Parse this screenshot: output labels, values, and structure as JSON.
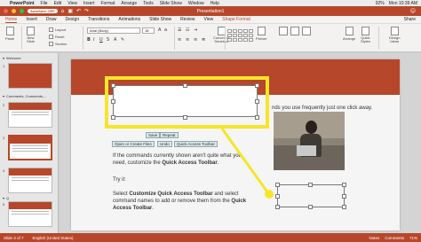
{
  "menubar": {
    "apple_glyph": "",
    "app_name": "PowerPoint",
    "items": [
      "File",
      "Edit",
      "View",
      "Insert",
      "Format",
      "Arrange",
      "Tools",
      "Slide Show",
      "Window",
      "Help"
    ],
    "battery": "92%",
    "clock": "Mon 10:39 AM"
  },
  "titlebar": {
    "autosave_label": "AutoSave",
    "autosave_state": "OFF",
    "document_title": "Presentation1",
    "traffic_lights": [
      "#ff5f57",
      "#febc2e",
      "#28c840"
    ]
  },
  "tabs": [
    "Home",
    "Insert",
    "Draw",
    "Design",
    "Transitions",
    "Animations",
    "Slide Show",
    "Review",
    "View",
    "Shape Format"
  ],
  "active_tab": "Home",
  "share_label": "Share",
  "ribbon": {
    "paste": "Paste",
    "new_slide": "New\nSlide",
    "layout": "Layout",
    "reset": "Reset",
    "section": "Section",
    "font_name": "Arial (Body)",
    "font_size": "18",
    "picture": "Picture",
    "arrange": "Arrange",
    "quick_styles": "Quick\nStyles",
    "convert_smartart": "Convert to\nSmartArt",
    "ideas": "Design\nIdeas"
  },
  "sidebar": {
    "sections": [
      {
        "label": "Welcome",
        "slides": [
          "1"
        ]
      },
      {
        "label": "Comments, Comments,...",
        "slides": [
          "2",
          "3",
          "4"
        ]
      },
      {
        "label": "Q",
        "slides": [
          "5"
        ]
      }
    ],
    "selected_slide": "3"
  },
  "slide": {
    "partial_text": "nds you use frequently just one click away.",
    "button_save": "Save",
    "button_repeat": "Repeat",
    "button_open": "Open or Create Files",
    "button_undo": "Undo",
    "button_qat": "Quick Access Toolbar",
    "para1_a": "If the commands currently shown aren't quite what you",
    "para1_b": "need, customize the ",
    "para1_bold": "Quick Access Toolbar",
    "para1_end": ".",
    "try_it": "Try it:",
    "para2_a": "Select ",
    "para2_bold1": "Customize Quick Access Toolbar",
    "para2_b": " and select",
    "para2_c": "command names to add or remove them from the ",
    "para2_bold2": "Quick",
    "para2_bold3": "Access Toolbar",
    "para2_end": "."
  },
  "statusbar": {
    "slide_position": "Slide 3 of 7",
    "language": "English (United States)",
    "notes": "Notes",
    "comments": "Comments",
    "zoom": "71%"
  },
  "colors": {
    "accent": "#b7472a",
    "highlight": "#f6e52a"
  }
}
